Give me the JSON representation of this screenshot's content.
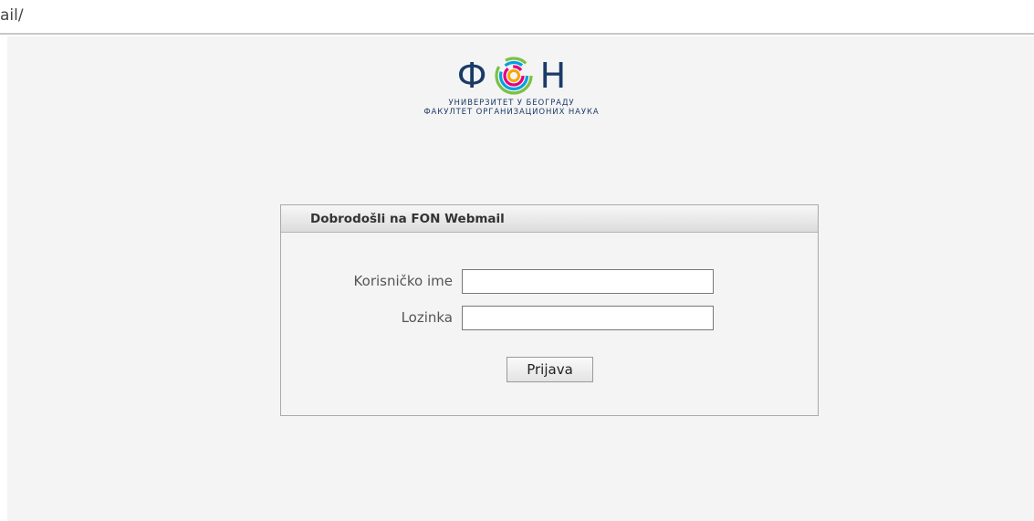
{
  "browser": {
    "url_fragment": "ail/"
  },
  "logo": {
    "letter_left": "Ф",
    "letter_right": "Н",
    "line1": "УНИВЕРЗИТЕТ У БЕОГРАДУ",
    "line2": "ФАКУЛТЕТ ОРГАНИЗАЦИОНИХ НАУКА",
    "colors": {
      "text": "#1b3a67",
      "ring_outer": "#7ac143",
      "ring_mid": "#00a0e3",
      "ring_inner": "#e6007e",
      "ring_accent": "#f7a600"
    }
  },
  "login": {
    "title": "Dobrodošli na FON Webmail",
    "username_label": "Korisničko ime",
    "username_value": "",
    "password_label": "Lozinka",
    "password_value": "",
    "submit_label": "Prijava"
  }
}
